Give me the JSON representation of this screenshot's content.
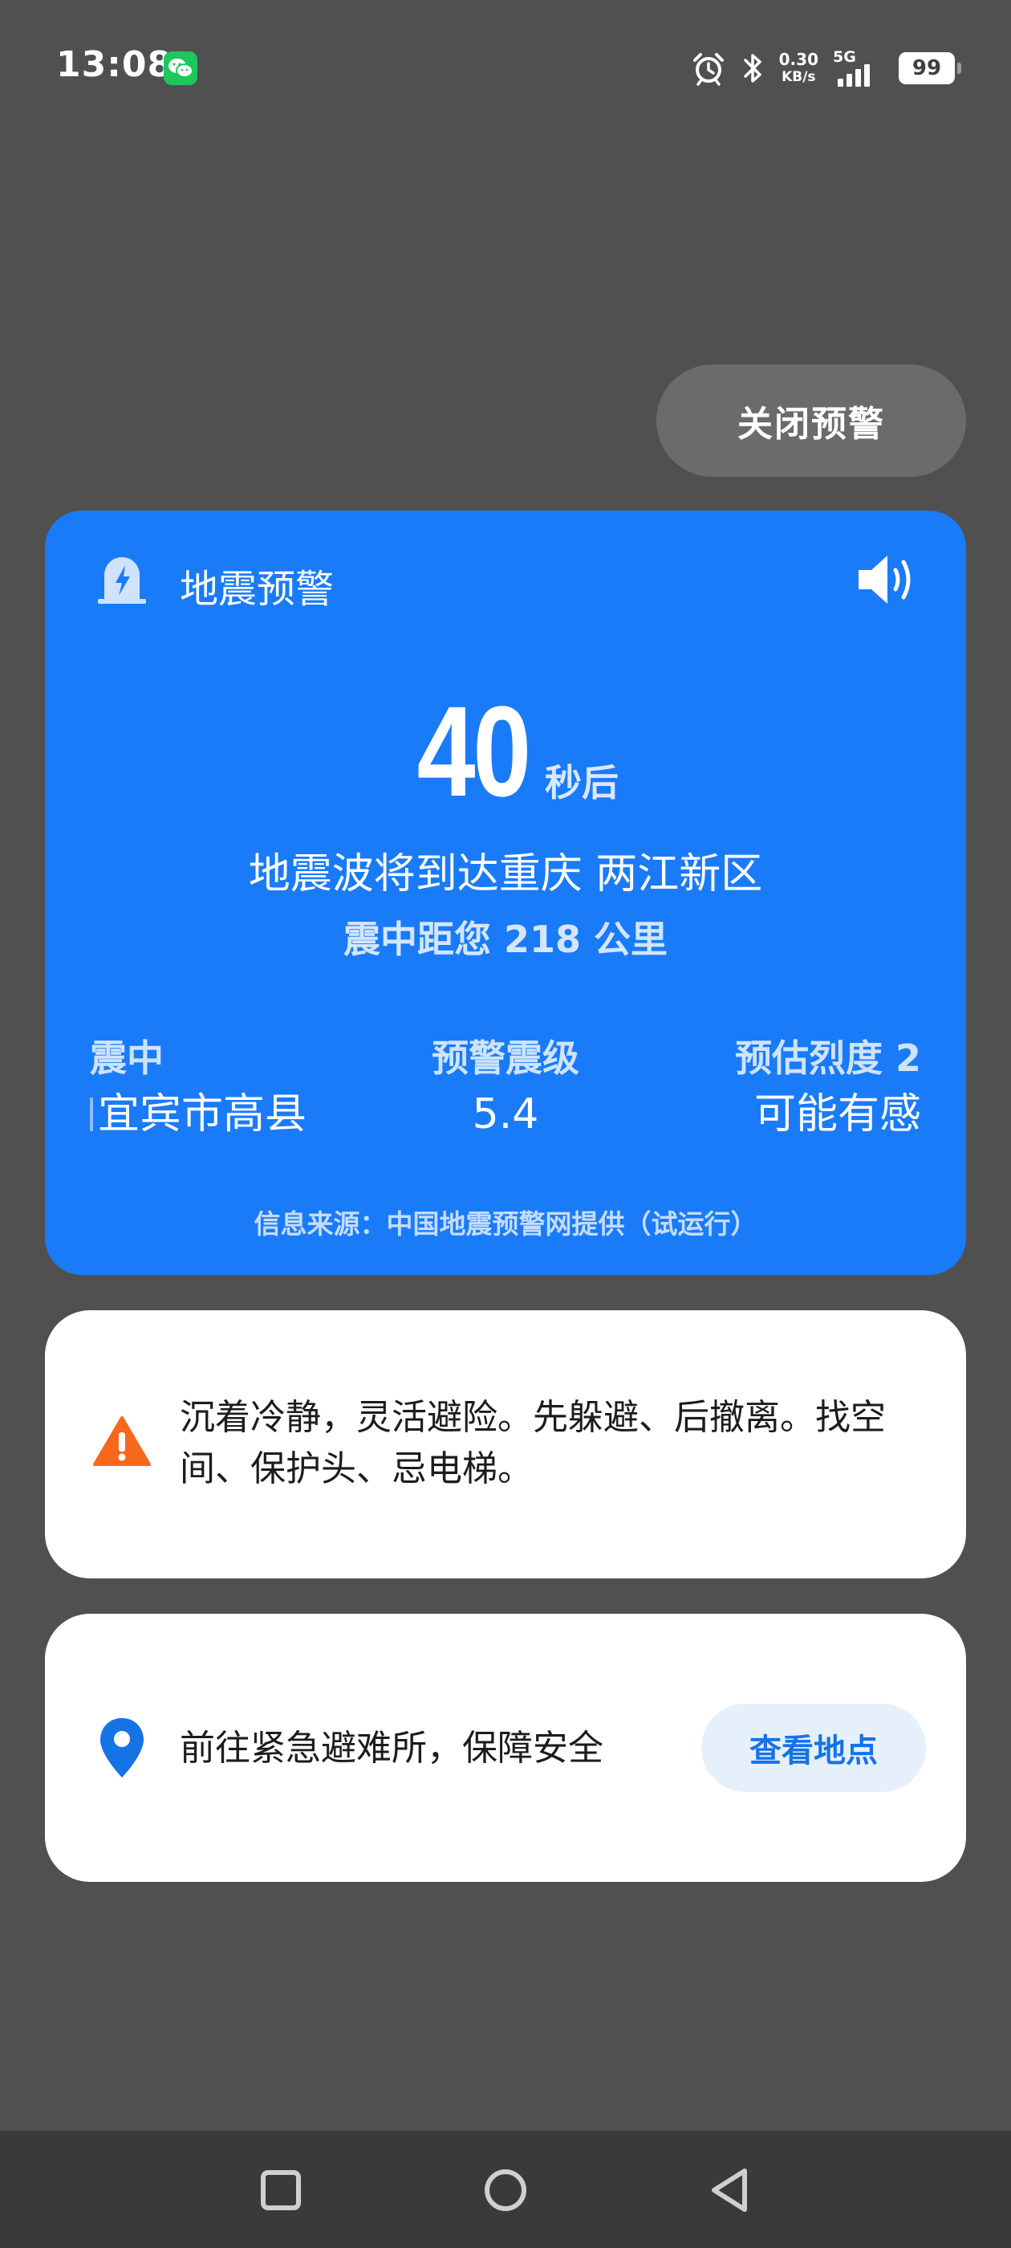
{
  "status_bar": {
    "time": "13:08",
    "net_speed_value": "0.30",
    "net_speed_unit": "KB/s",
    "network_type": "5G",
    "battery": "99",
    "signal_bars": 4
  },
  "actions": {
    "close_alert_label": "关闭预警"
  },
  "alert": {
    "title": "地震预警",
    "countdown_number": "40",
    "countdown_unit": "秒后",
    "arrival_text": "地震波将到达重庆 两江新区",
    "distance_text": "震中距您 218 公里",
    "epicenter_label": "震中",
    "epicenter_value": "宜宾市高县",
    "magnitude_label": "预警震级",
    "magnitude_value": "5.4",
    "intensity_label": "预估烈度 2",
    "intensity_value": "可能有感",
    "source_text": "信息来源：中国地震预警网提供（试运行）"
  },
  "safety_tip": {
    "text": "沉着冷静，灵活避险。先躲避、后撤离。找空间、保护头、忌电梯。"
  },
  "shelter": {
    "text": "前往紧急避难所，保障安全",
    "button_label": "查看地点"
  },
  "colors": {
    "background": "#505050",
    "alert_card": "#1a7bf9",
    "warning_orange": "#f7681c",
    "pin_blue": "#1673e6",
    "button_text_blue": "#1673e6",
    "nav_bar": "#3a3a3a"
  },
  "icons": {
    "alarm": "alarm-clock-icon",
    "bluetooth": "bluetooth-icon",
    "wechat": "wechat-icon",
    "alert_header": "emergency-beacon-icon",
    "speaker": "speaker-volume-icon",
    "warning": "warning-triangle-icon",
    "location": "location-pin-icon",
    "nav_recent": "square-icon",
    "nav_home": "circle-icon",
    "nav_back": "triangle-back-icon"
  }
}
